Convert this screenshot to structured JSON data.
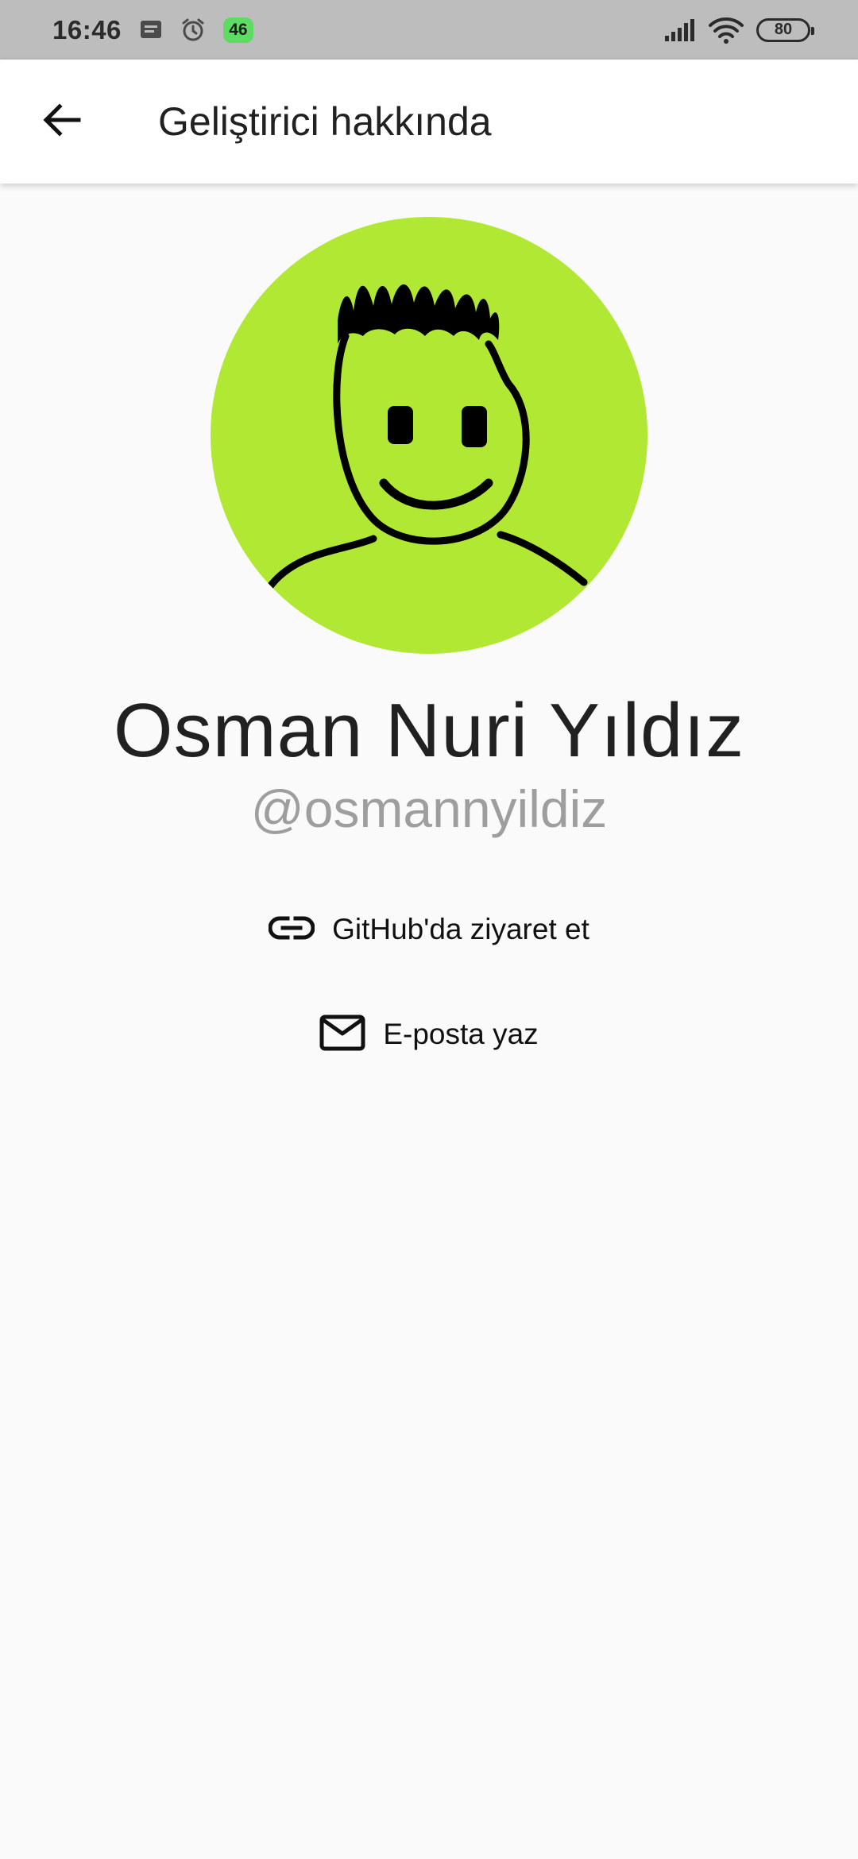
{
  "status_bar": {
    "time": "16:46",
    "notification_badge": "46",
    "battery": "80",
    "icons": [
      "message-icon",
      "alarm-icon",
      "signal-icon",
      "wifi-icon",
      "battery-icon"
    ]
  },
  "app_bar": {
    "title": "Geliştirici hakkında",
    "back_icon": "arrow-back-icon"
  },
  "profile": {
    "name": "Osman Nuri Yıldız",
    "handle": "@osmannyildiz",
    "avatar_bg": "#b0e833"
  },
  "actions": {
    "github_label": "GitHub'da ziyaret et",
    "email_label": "E-posta yaz"
  },
  "colors": {
    "status_bar": "#bdbdbd",
    "background": "#fafafa",
    "handle": "#9e9e9e",
    "badge": "#5ddb62"
  }
}
